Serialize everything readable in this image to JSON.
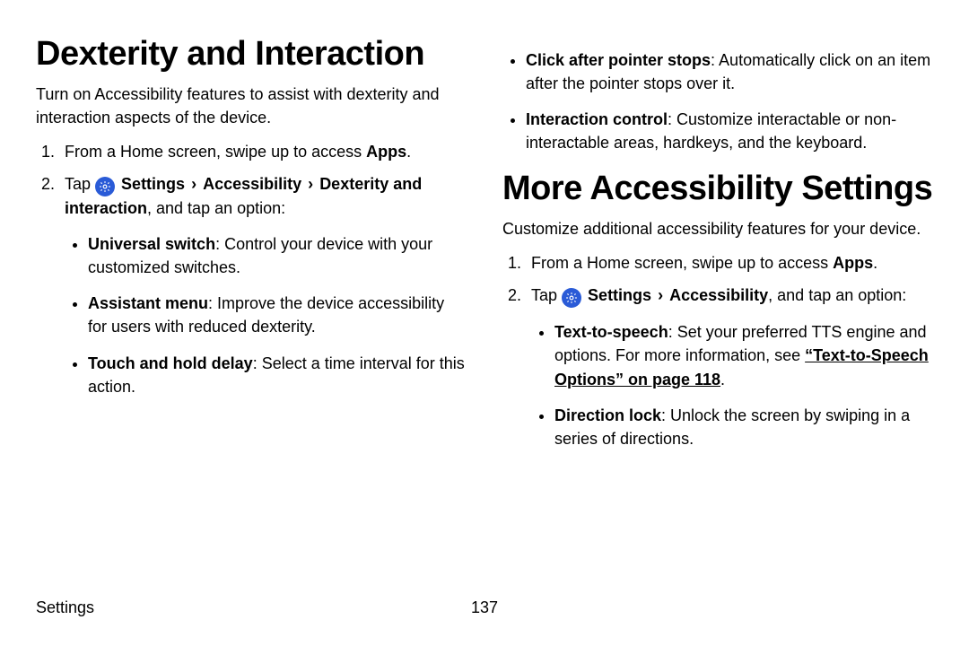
{
  "left": {
    "heading": "Dexterity and Interaction",
    "intro": "Turn on Accessibility features to assist with dexterity and interaction aspects of the device.",
    "step1_pre": "From a Home screen, swipe up to access ",
    "step1_apps": "Apps",
    "step1_post": ".",
    "step2_tap": "Tap ",
    "step2_settings": "Settings",
    "step2_accessibility": "Accessibility",
    "step2_dex": "Dexterity and interaction",
    "step2_post": ", and tap an option:",
    "bullets": {
      "b1_title": "Universal switch",
      "b1_text": ": Control your device with your customized switches.",
      "b2_title": "Assistant menu",
      "b2_text": ": Improve the device accessibility for users with reduced dexterity.",
      "b3_title": "Touch and hold delay",
      "b3_text": ": Select a time interval for this action."
    }
  },
  "right_top": {
    "b1_title": "Click after pointer stops",
    "b1_text": ": Automatically click on an item after the pointer stops over it.",
    "b2_title": "Interaction control",
    "b2_text": ": Customize interactable or non-interactable areas, hardkeys, and the keyboard."
  },
  "right": {
    "heading": "More Accessibility Settings",
    "intro": "Customize additional accessibility features for your device.",
    "step1_pre": "From a Home screen, swipe up to access ",
    "step1_apps": "Apps",
    "step1_post": ".",
    "step2_tap": "Tap ",
    "step2_settings": "Settings",
    "step2_accessibility": "Accessibility",
    "step2_post": ", and tap an option:",
    "bullets": {
      "b1_title": "Text-to-speech",
      "b1_text": ": Set your preferred TTS engine and options. For more information, see ",
      "b1_link": "“Text-to-Speech Options” on page 118",
      "b1_after": ".",
      "b2_title": "Direction lock",
      "b2_text": ": Unlock the screen by swiping in a series of directions."
    }
  },
  "chevron": "›",
  "footer": {
    "section": "Settings",
    "page": "137"
  }
}
